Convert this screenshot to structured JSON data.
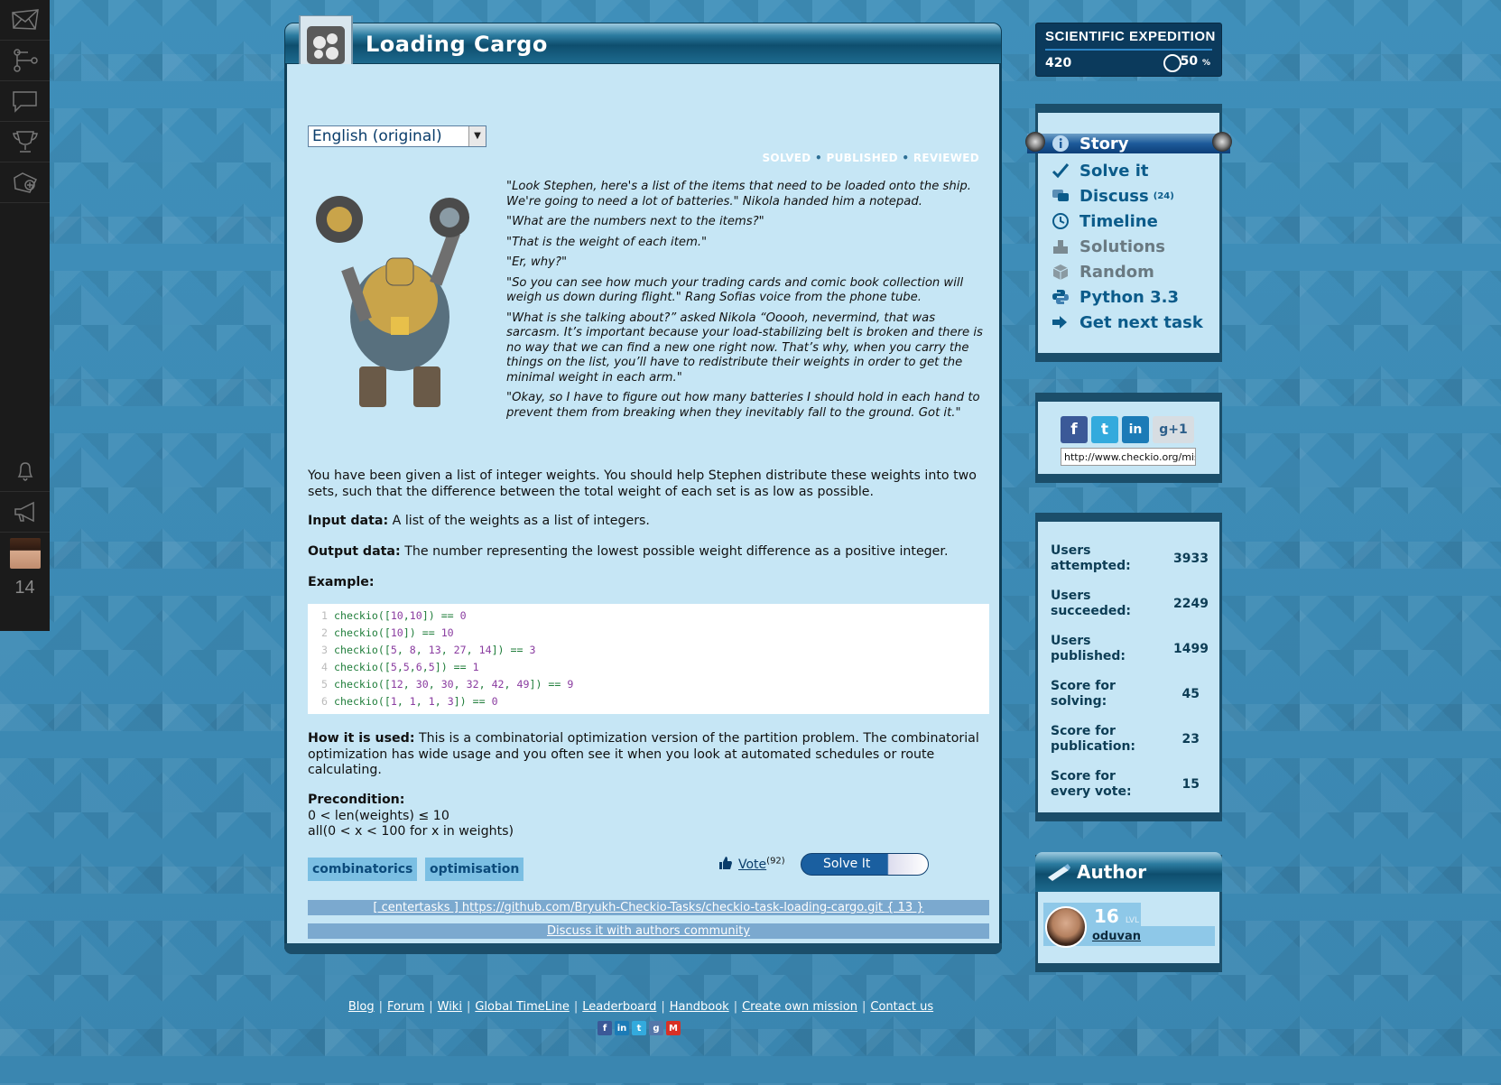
{
  "leftnav": {
    "items": [
      "mail-icon",
      "tree-icon",
      "chat-icon",
      "trophy-icon",
      "map-add-icon"
    ],
    "bottom": [
      "bell-icon",
      "megaphone-icon"
    ],
    "level": "14"
  },
  "mission": {
    "title": "Loading Cargo",
    "language": "English (original)",
    "statuses": [
      "SOLVED",
      "PUBLISHED",
      "REVIEWED"
    ],
    "story": [
      "\"Look Stephen, here's a list of the items that need to be loaded onto the ship. We're going to need a lot of batteries.\" Nikola handed him a notepad.",
      "\"What are the numbers next to the items?\"",
      "\"That is the weight of each item.\"",
      "\"Er, why?\"",
      "\"So you can see how much your trading cards and comic book collection will weigh us down during flight.\" Rang Sofias voice from the phone tube.",
      "\"What is she talking about?” asked Nikola “Ooooh, nevermind, that was sarcasm. It’s important because your load-stabilizing belt is broken and there is no way that we can find a new one right now. That’s why, when you carry the things on the list, you’ll have to redistribute their weights in order to get the minimal weight in each arm.\"",
      "\"Okay, so I have to figure out how many batteries I should hold in each hand to prevent them from breaking when they inevitably fall to the ground. Got it.\""
    ],
    "description": "You have been given a list of integer weights. You should help Stephen distribute these weights into two sets, such that the difference between the total weight of each set is as low as possible.",
    "input_label": "Input data:",
    "input_text": "A list of the weights as a list of integers.",
    "output_label": "Output data:",
    "output_text": "The number representing the lowest possible weight difference as a positive integer.",
    "example_label": "Example:",
    "code": [
      {
        "n": "1",
        "text": "checkio([10,10]) == 0"
      },
      {
        "n": "2",
        "text": "checkio([10]) == 10"
      },
      {
        "n": "3",
        "text": "checkio([5, 8, 13, 27, 14]) == 3"
      },
      {
        "n": "4",
        "text": "checkio([5,5,6,5]) == 1"
      },
      {
        "n": "5",
        "text": "checkio([12, 30, 30, 32, 42, 49]) == 9"
      },
      {
        "n": "6",
        "text": "checkio([1, 1, 1, 3]) == 0"
      }
    ],
    "how_label": "How it is used:",
    "how_text": "This is a combinatorial optimization version of the partition problem. The combinatorial optimization has wide usage and you often see it when you look at automated schedules or route calculating.",
    "precondition_label": "Precondition:",
    "precondition_lines": [
      "0 < len(weights) ≤ 10",
      "all(0 < x < 100 for x in weights)"
    ],
    "tags": [
      "combinatorics",
      "optimisation"
    ],
    "vote_label": "Vote",
    "vote_count": "(92)",
    "solve_label": "Solve It",
    "repo_link": "[ centertasks ] https://github.com/Bryukh-Checkio-Tasks/checkio-task-loading-cargo.git { 13 }",
    "discuss_link": "Discuss it with authors community"
  },
  "expedition": {
    "title": "SCIENTIFIC EXPEDITION",
    "score": "420",
    "percent": "50",
    "percent_unit": "%"
  },
  "menu": {
    "items": [
      {
        "label": "Story",
        "icon": "info-icon",
        "active": true
      },
      {
        "label": "Solve it",
        "icon": "check-icon"
      },
      {
        "label": "Discuss",
        "icon": "discuss-icon",
        "count": "(24)"
      },
      {
        "label": "Timeline",
        "icon": "clock-icon"
      },
      {
        "label": "Solutions",
        "icon": "solutions-icon",
        "grey": true
      },
      {
        "label": "Random",
        "icon": "random-box-icon",
        "grey": true
      },
      {
        "label": "Python 3.3",
        "icon": "python-icon"
      },
      {
        "label": "Get next task",
        "icon": "next-arrow-icon"
      }
    ]
  },
  "share": {
    "url": "http://www.checkio.org/mission/loading-cargo/",
    "networks": [
      "f",
      "t",
      "in",
      "g+1"
    ]
  },
  "stats": [
    {
      "label": "Users attempted:",
      "value": "3933"
    },
    {
      "label": "Users succeeded:",
      "value": "2249"
    },
    {
      "label": "Users published:",
      "value": "1499"
    },
    {
      "label": "Score for solving:",
      "value": "45"
    },
    {
      "label": "Score for publication:",
      "value": "23"
    },
    {
      "label": "Score for every vote:",
      "value": "15"
    }
  ],
  "author": {
    "title": "Author",
    "level": "16",
    "level_unit": "LVL",
    "name": "oduvan"
  },
  "footer": {
    "links": [
      "Blog",
      "Forum",
      "Wiki",
      "Global TimeLine",
      "Leaderboard",
      "Handbook",
      "Create own mission",
      "Contact us"
    ]
  },
  "colors": {
    "accent": "#0b5b8a",
    "panel": "#c6e6f5",
    "nav": "#1b1b1b"
  }
}
